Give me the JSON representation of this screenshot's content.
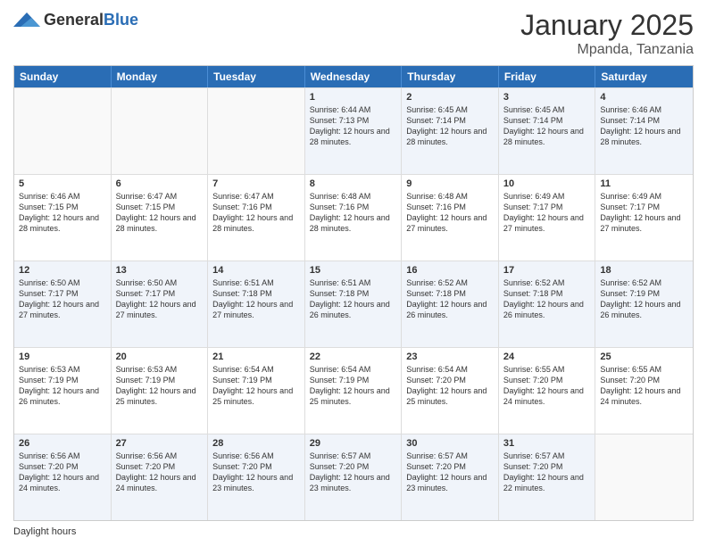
{
  "header": {
    "logo_general": "General",
    "logo_blue": "Blue",
    "month_title": "January 2025",
    "location": "Mpanda, Tanzania"
  },
  "days_of_week": [
    "Sunday",
    "Monday",
    "Tuesday",
    "Wednesday",
    "Thursday",
    "Friday",
    "Saturday"
  ],
  "weeks": [
    [
      {
        "day": "",
        "sunrise": "",
        "sunset": "",
        "daylight": "",
        "empty": true
      },
      {
        "day": "",
        "sunrise": "",
        "sunset": "",
        "daylight": "",
        "empty": true
      },
      {
        "day": "",
        "sunrise": "",
        "sunset": "",
        "daylight": "",
        "empty": true
      },
      {
        "day": "1",
        "sunrise": "Sunrise: 6:44 AM",
        "sunset": "Sunset: 7:13 PM",
        "daylight": "Daylight: 12 hours and 28 minutes.",
        "empty": false
      },
      {
        "day": "2",
        "sunrise": "Sunrise: 6:45 AM",
        "sunset": "Sunset: 7:14 PM",
        "daylight": "Daylight: 12 hours and 28 minutes.",
        "empty": false
      },
      {
        "day": "3",
        "sunrise": "Sunrise: 6:45 AM",
        "sunset": "Sunset: 7:14 PM",
        "daylight": "Daylight: 12 hours and 28 minutes.",
        "empty": false
      },
      {
        "day": "4",
        "sunrise": "Sunrise: 6:46 AM",
        "sunset": "Sunset: 7:14 PM",
        "daylight": "Daylight: 12 hours and 28 minutes.",
        "empty": false
      }
    ],
    [
      {
        "day": "5",
        "sunrise": "Sunrise: 6:46 AM",
        "sunset": "Sunset: 7:15 PM",
        "daylight": "Daylight: 12 hours and 28 minutes.",
        "empty": false
      },
      {
        "day": "6",
        "sunrise": "Sunrise: 6:47 AM",
        "sunset": "Sunset: 7:15 PM",
        "daylight": "Daylight: 12 hours and 28 minutes.",
        "empty": false
      },
      {
        "day": "7",
        "sunrise": "Sunrise: 6:47 AM",
        "sunset": "Sunset: 7:16 PM",
        "daylight": "Daylight: 12 hours and 28 minutes.",
        "empty": false
      },
      {
        "day": "8",
        "sunrise": "Sunrise: 6:48 AM",
        "sunset": "Sunset: 7:16 PM",
        "daylight": "Daylight: 12 hours and 28 minutes.",
        "empty": false
      },
      {
        "day": "9",
        "sunrise": "Sunrise: 6:48 AM",
        "sunset": "Sunset: 7:16 PM",
        "daylight": "Daylight: 12 hours and 27 minutes.",
        "empty": false
      },
      {
        "day": "10",
        "sunrise": "Sunrise: 6:49 AM",
        "sunset": "Sunset: 7:17 PM",
        "daylight": "Daylight: 12 hours and 27 minutes.",
        "empty": false
      },
      {
        "day": "11",
        "sunrise": "Sunrise: 6:49 AM",
        "sunset": "Sunset: 7:17 PM",
        "daylight": "Daylight: 12 hours and 27 minutes.",
        "empty": false
      }
    ],
    [
      {
        "day": "12",
        "sunrise": "Sunrise: 6:50 AM",
        "sunset": "Sunset: 7:17 PM",
        "daylight": "Daylight: 12 hours and 27 minutes.",
        "empty": false
      },
      {
        "day": "13",
        "sunrise": "Sunrise: 6:50 AM",
        "sunset": "Sunset: 7:17 PM",
        "daylight": "Daylight: 12 hours and 27 minutes.",
        "empty": false
      },
      {
        "day": "14",
        "sunrise": "Sunrise: 6:51 AM",
        "sunset": "Sunset: 7:18 PM",
        "daylight": "Daylight: 12 hours and 27 minutes.",
        "empty": false
      },
      {
        "day": "15",
        "sunrise": "Sunrise: 6:51 AM",
        "sunset": "Sunset: 7:18 PM",
        "daylight": "Daylight: 12 hours and 26 minutes.",
        "empty": false
      },
      {
        "day": "16",
        "sunrise": "Sunrise: 6:52 AM",
        "sunset": "Sunset: 7:18 PM",
        "daylight": "Daylight: 12 hours and 26 minutes.",
        "empty": false
      },
      {
        "day": "17",
        "sunrise": "Sunrise: 6:52 AM",
        "sunset": "Sunset: 7:18 PM",
        "daylight": "Daylight: 12 hours and 26 minutes.",
        "empty": false
      },
      {
        "day": "18",
        "sunrise": "Sunrise: 6:52 AM",
        "sunset": "Sunset: 7:19 PM",
        "daylight": "Daylight: 12 hours and 26 minutes.",
        "empty": false
      }
    ],
    [
      {
        "day": "19",
        "sunrise": "Sunrise: 6:53 AM",
        "sunset": "Sunset: 7:19 PM",
        "daylight": "Daylight: 12 hours and 26 minutes.",
        "empty": false
      },
      {
        "day": "20",
        "sunrise": "Sunrise: 6:53 AM",
        "sunset": "Sunset: 7:19 PM",
        "daylight": "Daylight: 12 hours and 25 minutes.",
        "empty": false
      },
      {
        "day": "21",
        "sunrise": "Sunrise: 6:54 AM",
        "sunset": "Sunset: 7:19 PM",
        "daylight": "Daylight: 12 hours and 25 minutes.",
        "empty": false
      },
      {
        "day": "22",
        "sunrise": "Sunrise: 6:54 AM",
        "sunset": "Sunset: 7:19 PM",
        "daylight": "Daylight: 12 hours and 25 minutes.",
        "empty": false
      },
      {
        "day": "23",
        "sunrise": "Sunrise: 6:54 AM",
        "sunset": "Sunset: 7:20 PM",
        "daylight": "Daylight: 12 hours and 25 minutes.",
        "empty": false
      },
      {
        "day": "24",
        "sunrise": "Sunrise: 6:55 AM",
        "sunset": "Sunset: 7:20 PM",
        "daylight": "Daylight: 12 hours and 24 minutes.",
        "empty": false
      },
      {
        "day": "25",
        "sunrise": "Sunrise: 6:55 AM",
        "sunset": "Sunset: 7:20 PM",
        "daylight": "Daylight: 12 hours and 24 minutes.",
        "empty": false
      }
    ],
    [
      {
        "day": "26",
        "sunrise": "Sunrise: 6:56 AM",
        "sunset": "Sunset: 7:20 PM",
        "daylight": "Daylight: 12 hours and 24 minutes.",
        "empty": false
      },
      {
        "day": "27",
        "sunrise": "Sunrise: 6:56 AM",
        "sunset": "Sunset: 7:20 PM",
        "daylight": "Daylight: 12 hours and 24 minutes.",
        "empty": false
      },
      {
        "day": "28",
        "sunrise": "Sunrise: 6:56 AM",
        "sunset": "Sunset: 7:20 PM",
        "daylight": "Daylight: 12 hours and 23 minutes.",
        "empty": false
      },
      {
        "day": "29",
        "sunrise": "Sunrise: 6:57 AM",
        "sunset": "Sunset: 7:20 PM",
        "daylight": "Daylight: 12 hours and 23 minutes.",
        "empty": false
      },
      {
        "day": "30",
        "sunrise": "Sunrise: 6:57 AM",
        "sunset": "Sunset: 7:20 PM",
        "daylight": "Daylight: 12 hours and 23 minutes.",
        "empty": false
      },
      {
        "day": "31",
        "sunrise": "Sunrise: 6:57 AM",
        "sunset": "Sunset: 7:20 PM",
        "daylight": "Daylight: 12 hours and 22 minutes.",
        "empty": false
      },
      {
        "day": "",
        "sunrise": "",
        "sunset": "",
        "daylight": "",
        "empty": true
      }
    ]
  ],
  "footer": {
    "daylight_label": "Daylight hours"
  }
}
